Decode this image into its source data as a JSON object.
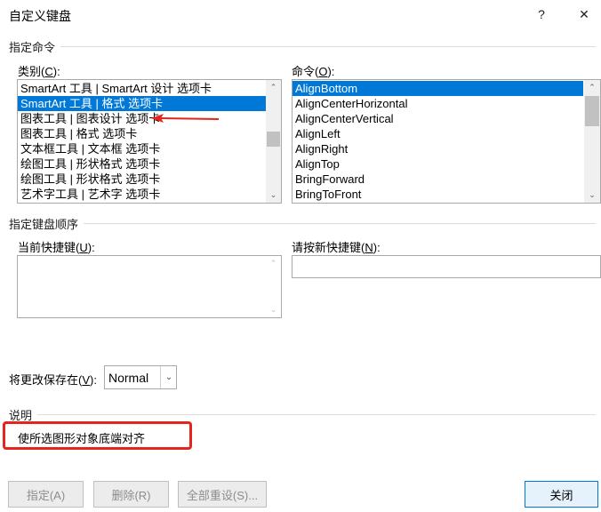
{
  "window": {
    "title": "自定义键盘",
    "help_label": "?",
    "close_glyph": "✕"
  },
  "specify_command": {
    "group_label": "指定命令",
    "categories_label": "类别(",
    "categories_key": "C",
    "categories_suffix": "):",
    "categories": [
      "SmartArt 工具 | SmartArt 设计 选项卡",
      "SmartArt 工具 | 格式 选项卡",
      "图表工具 | 图表设计 选项卡",
      "图表工具 | 格式 选项卡",
      "文本框工具 | 文本框 选项卡",
      "绘图工具 | 形状格式 选项卡",
      "绘图工具 | 形状格式 选项卡",
      "艺术字工具 | 艺术字 选项卡"
    ],
    "commands_label": "命令(",
    "commands_key": "O",
    "commands_suffix": "):",
    "commands": [
      "AlignBottom",
      "AlignCenterHorizontal",
      "AlignCenterVertical",
      "AlignLeft",
      "AlignRight",
      "AlignTop",
      "BringForward",
      "BringToFront"
    ]
  },
  "keyboard_sequence": {
    "group_label": "指定键盘顺序",
    "current_keys_label": "当前快捷键(",
    "current_keys_key": "U",
    "current_keys_suffix": "):",
    "new_key_label": "请按新快捷键(",
    "new_key_key": "N",
    "new_key_suffix": "):",
    "new_key_value": ""
  },
  "save_in": {
    "label": "将更改保存在(",
    "label_key": "V",
    "label_suffix": "):",
    "value": "Normal"
  },
  "description": {
    "group_label": "说明",
    "text": "使所选图形对象底端对齐"
  },
  "buttons": {
    "assign": "指定(A)",
    "remove": "删除(R)",
    "reset_all": "全部重设(S)...",
    "close": "关闭"
  },
  "colors": {
    "selection": "#0078d7",
    "annotation_red": "#e5241d"
  }
}
